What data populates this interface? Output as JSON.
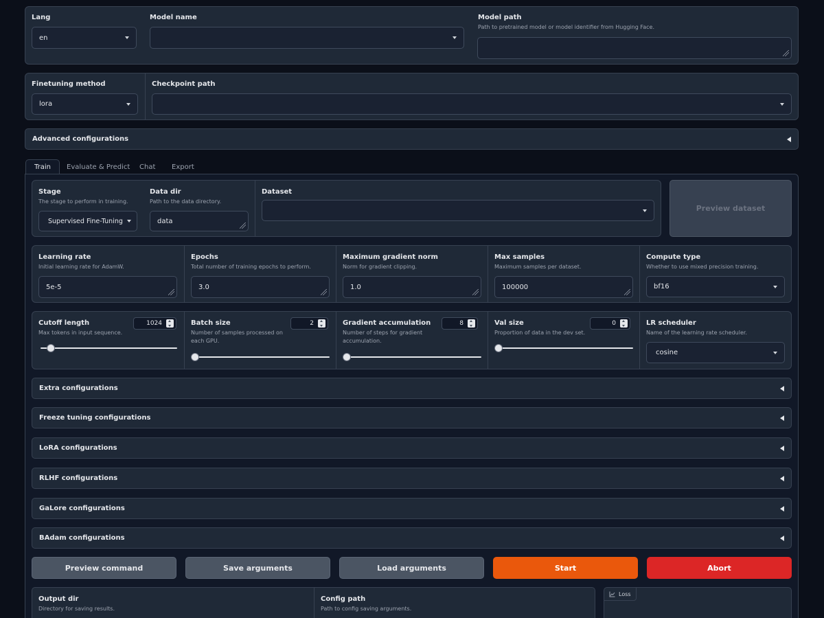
{
  "top": {
    "lang": {
      "label": "Lang",
      "value": "en"
    },
    "model_name": {
      "label": "Model name",
      "value": ""
    },
    "model_path": {
      "label": "Model path",
      "info": "Path to pretrained model or model identifier from Hugging Face.",
      "value": ""
    }
  },
  "method": {
    "finetuning": {
      "label": "Finetuning method",
      "value": "lora"
    },
    "checkpoint": {
      "label": "Checkpoint path",
      "value": ""
    }
  },
  "advanced_label": "Advanced configurations",
  "tabs": [
    {
      "label": "Train",
      "active": true
    },
    {
      "label": "Evaluate & Predict",
      "active": false
    },
    {
      "label": "Chat",
      "active": false
    },
    {
      "label": "Export",
      "active": false
    }
  ],
  "train": {
    "stage": {
      "label": "Stage",
      "info": "The stage to perform in training.",
      "value": "Supervised Fine-Tuning"
    },
    "data_dir": {
      "label": "Data dir",
      "info": "Path to the data directory.",
      "value": "data"
    },
    "dataset": {
      "label": "Dataset",
      "value": ""
    },
    "preview_dataset": "Preview dataset",
    "learning_rate": {
      "label": "Learning rate",
      "info": "Initial learning rate for AdamW.",
      "value": "5e-5"
    },
    "epochs": {
      "label": "Epochs",
      "info": "Total number of training epochs to perform.",
      "value": "3.0"
    },
    "max_grad_norm": {
      "label": "Maximum gradient norm",
      "info": "Norm for gradient clipping.",
      "value": "1.0"
    },
    "max_samples": {
      "label": "Max samples",
      "info": "Maximum samples per dataset.",
      "value": "100000"
    },
    "compute_type": {
      "label": "Compute type",
      "info": "Whether to use mixed precision training.",
      "value": "bf16"
    },
    "cutoff_len": {
      "label": "Cutoff length",
      "info": "Max tokens in input sequence.",
      "value": "1024",
      "fraction": 0.05
    },
    "batch_size": {
      "label": "Batch size",
      "info": "Number of samples processed on each GPU.",
      "value": "2",
      "fraction": 0.0
    },
    "grad_accum": {
      "label": "Gradient accumulation",
      "info": "Number of steps for gradient accumulation.",
      "value": "8",
      "fraction": 0.0
    },
    "val_size": {
      "label": "Val size",
      "info": "Proportion of data in the dev set.",
      "value": "0",
      "fraction": 0.0
    },
    "lr_scheduler": {
      "label": "LR scheduler",
      "info": "Name of the learning rate scheduler.",
      "value": "cosine"
    },
    "accordions": [
      "Extra configurations",
      "Freeze tuning configurations",
      "LoRA configurations",
      "RLHF configurations",
      "GaLore configurations",
      "BAdam configurations"
    ],
    "buttons": {
      "preview_command": "Preview command",
      "save_arguments": "Save arguments",
      "load_arguments": "Load arguments",
      "start": "Start",
      "abort": "Abort"
    },
    "output_dir": {
      "label": "Output dir",
      "info": "Directory for saving results."
    },
    "config_path": {
      "label": "Config path",
      "info": "Path to config saving arguments."
    },
    "loss_label": "Loss"
  }
}
